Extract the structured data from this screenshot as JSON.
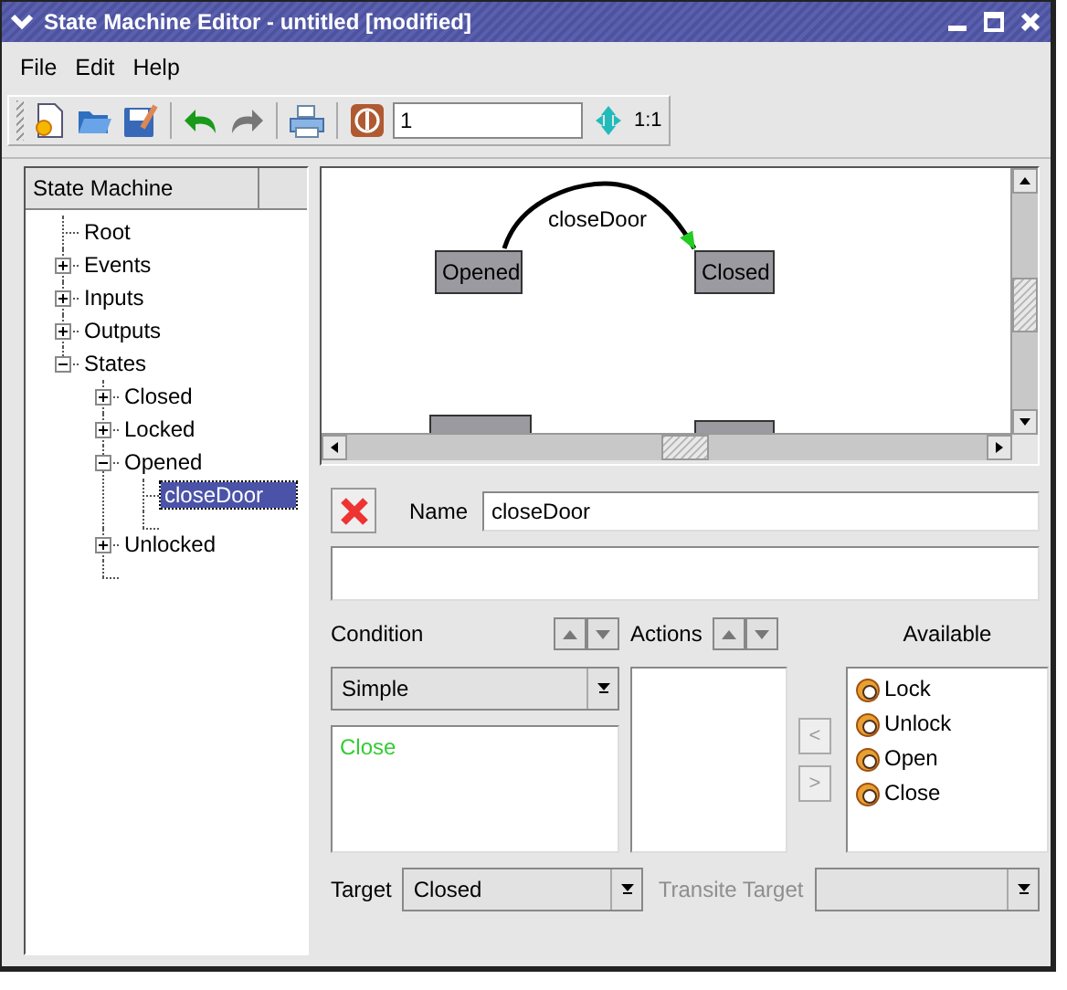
{
  "window": {
    "title": "State Machine Editor - untitled [modified]"
  },
  "menu": [
    {
      "label": "File"
    },
    {
      "label": "Edit"
    },
    {
      "label": "Help"
    }
  ],
  "toolbar": {
    "zoom_value": "1",
    "zoom_label": "1:1"
  },
  "tree": {
    "header": "State Machine",
    "items": [
      {
        "label": "Root",
        "selected": false
      },
      {
        "label": "Events",
        "selected": false,
        "expanded": false
      },
      {
        "label": "Inputs",
        "selected": false,
        "expanded": false
      },
      {
        "label": "Outputs",
        "selected": false,
        "expanded": false
      },
      {
        "label": "States",
        "selected": false,
        "expanded": true,
        "children": [
          {
            "label": "Closed",
            "selected": false,
            "expanded": false
          },
          {
            "label": "Locked",
            "selected": false,
            "expanded": false
          },
          {
            "label": "Opened",
            "selected": false,
            "expanded": true,
            "children": [
              {
                "label": "closeDoor",
                "selected": true
              }
            ]
          },
          {
            "label": "Unlocked",
            "selected": false,
            "expanded": false
          }
        ]
      }
    ]
  },
  "diagram": {
    "nodes": [
      {
        "kind": "state",
        "label": "Opened"
      },
      {
        "kind": "state",
        "label": "Closed"
      },
      {
        "kind": "partial"
      },
      {
        "kind": "partial"
      }
    ],
    "transition": {
      "label": "closeDoor"
    }
  },
  "editor": {
    "name_label": "Name",
    "name_value": "closeDoor",
    "condition_label": "Condition",
    "condition_type": "Simple",
    "condition_text": "Close",
    "actions_label": "Actions",
    "available_label": "Available",
    "available": [
      {
        "label": "Lock"
      },
      {
        "label": "Unlock"
      },
      {
        "label": "Open"
      },
      {
        "label": "Close"
      }
    ],
    "move_buttons": [
      {
        "label": "<",
        "disabled": true
      },
      {
        "label": ">",
        "disabled": true
      }
    ],
    "target_label": "Target",
    "target_value": "Closed",
    "transite_label": "Transite Target",
    "transite_disabled": true
  }
}
